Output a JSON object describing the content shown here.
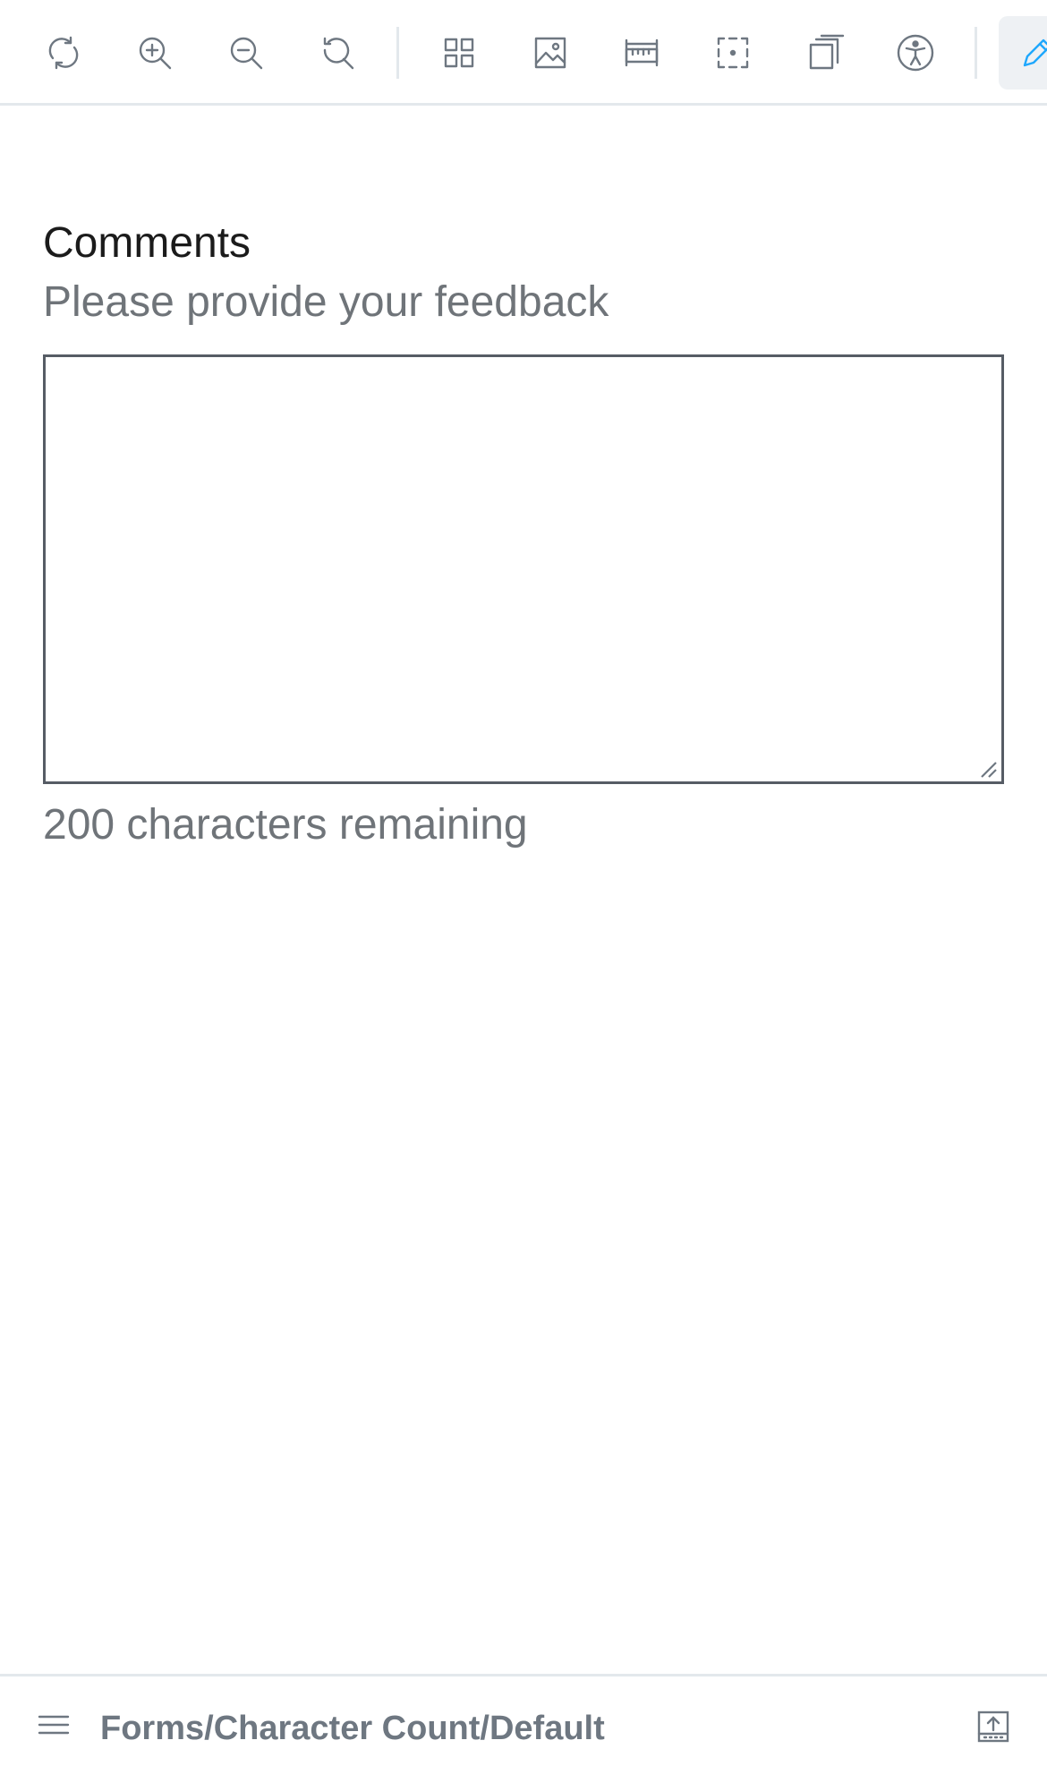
{
  "toolbar": {
    "tools": [
      {
        "name": "remount-icon"
      },
      {
        "name": "zoom-in-icon"
      },
      {
        "name": "zoom-out-icon"
      },
      {
        "name": "zoom-reset-icon"
      },
      {
        "name": "grid-icon"
      },
      {
        "name": "background-icon"
      },
      {
        "name": "ruler-icon"
      },
      {
        "name": "outline-icon"
      },
      {
        "name": "viewport-icon"
      },
      {
        "name": "accessibility-icon"
      },
      {
        "name": "pencil-icon",
        "active": true
      }
    ],
    "accent_color": "#1ea7fd"
  },
  "field": {
    "label": "Comments",
    "hint": "Please provide your feedback",
    "value": "",
    "char_count": "200 characters remaining",
    "border_color": "#565c65"
  },
  "bottom_bar": {
    "story_path": "Forms/Character Count/Default",
    "menu_icon": "menu-icon",
    "addon_icon": "addon-panel-icon"
  }
}
